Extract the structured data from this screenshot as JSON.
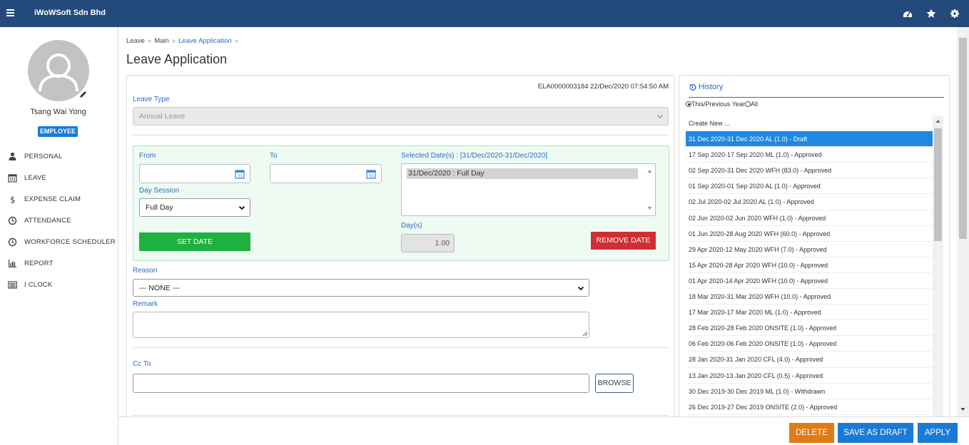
{
  "topbar": {
    "company": "iWoWSoft Sdn Bhd"
  },
  "profile": {
    "name": "Tsang Wai Yong",
    "role": "EMPLOYEE"
  },
  "menu": [
    {
      "label": "PERSONAL",
      "icon": "user-icon"
    },
    {
      "label": "LEAVE",
      "icon": "calendar-icon"
    },
    {
      "label": "EXPENSE CLAIM",
      "icon": "dollar-icon"
    },
    {
      "label": "ATTENDANCE",
      "icon": "clock-icon"
    },
    {
      "label": "WORKFORCE SCHEDULER",
      "icon": "clock-icon"
    },
    {
      "label": "REPORT",
      "icon": "bar-chart-icon"
    },
    {
      "label": "I CLOCK",
      "icon": "list-icon"
    }
  ],
  "breadcrumb": [
    "Leave",
    "Main",
    "Leave Application"
  ],
  "page": {
    "title": "Leave Application"
  },
  "form": {
    "ref": "ELA0000003184 22/Dec/2020 07:54:50 AM",
    "leave_type_label": "Leave Type",
    "leave_type_value": "Annual Leave",
    "from_label": "From",
    "to_label": "To",
    "from_value": "",
    "to_value": "",
    "day_session_label": "Day Session",
    "day_session_value": "Full Day",
    "set_date": "SET DATE",
    "selected_dates_label": "Selected Date(s) : [31/Dec/2020-31/Dec/2020]",
    "selected_dates": [
      "31/Dec/2020 : Full Day"
    ],
    "days_label": "Day(s)",
    "days_value": "1.00",
    "remove_date": "REMOVE DATE",
    "reason_label": "Reason",
    "reason_value": "--- NONE ---",
    "remark_label": "Remark",
    "cc_label": "Cc To",
    "browse": "BROWSE"
  },
  "history": {
    "title": "History",
    "filter_options": [
      "This/Previous Year",
      "All"
    ],
    "filter_selected": "This/Previous Year",
    "items": [
      "Create New ...",
      "31 Dec 2020-31 Dec 2020 AL (1.0) - Draft",
      "17 Sep 2020-17 Sep 2020 ML (1.0) - Approved",
      "02 Sep 2020-31 Dec 2020 WFH (83.0) - Approved",
      "01 Sep 2020-01 Sep 2020 AL (1.0) - Approved",
      "02 Jul 2020-02 Jul 2020 AL (1.0) - Approved",
      "02 Jun 2020-02 Jun 2020 WFH (1.0) - Approved",
      "01 Jun 2020-28 Aug 2020 WFH (60.0) - Approved",
      "29 Apr 2020-12 May 2020 WFH (7.0) - Approved",
      "15 Apr 2020-28 Apr 2020 WFH (10.0) - Approved",
      "01 Apr 2020-14 Apr 2020 WFH (10.0) - Approved",
      "18 Mar 2020-31 Mar 2020 WFH (10.0) - Approved",
      "17 Mar 2020-17 Mar 2020 ML (1.0) - Approved",
      "28 Feb 2020-28 Feb 2020 ONSITE (1.0) - Approved",
      "06 Feb 2020-06 Feb 2020 ONSITE (1.0) - Approved",
      "28 Jan 2020-31 Jan 2020 CFL (4.0) - Approved",
      "13 Jan 2020-13 Jan 2020 CFL (0.5) - Approved",
      "30 Dec 2019-30 Dec 2019 ML (1.0) - Withdrawn",
      "26 Dec 2019-27 Dec 2019 ONSITE (2.0) - Approved"
    ],
    "active_index": 1
  },
  "actions": {
    "delete": "DELETE",
    "save_draft": "SAVE AS DRAFT",
    "apply": "APPLY"
  },
  "colors": {
    "topbar": "#234a7a",
    "accent": "#2a6dbf",
    "delete": "#e07b15",
    "primary": "#1a7bd6",
    "set_date": "#1fb13f",
    "remove_date": "#cf2f34"
  }
}
